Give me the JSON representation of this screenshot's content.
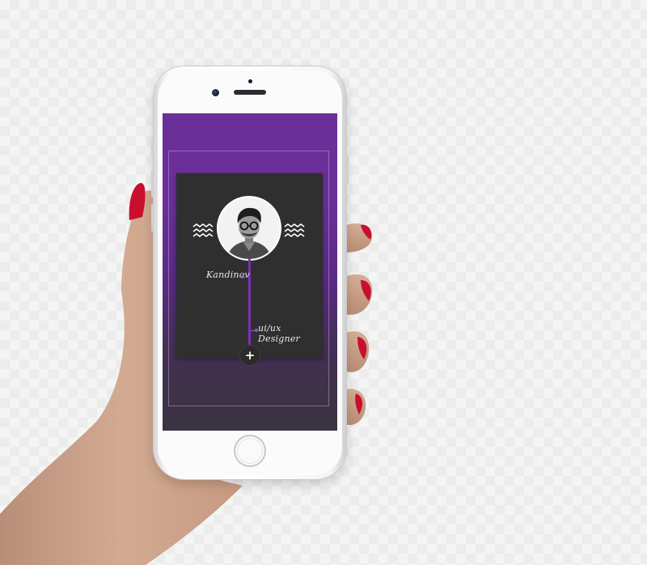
{
  "profile_card": {
    "name": "Kandinov",
    "role": "ui/ux Designer",
    "avatar_icon": "portrait-photo",
    "left_decoration_icon": "zigzag-wave-icon",
    "right_decoration_icon": "zigzag-wave-icon"
  },
  "actions": {
    "add_symbol": "+",
    "add_icon": "plus-icon"
  },
  "device": {
    "home_button_icon": "home-button"
  },
  "colors": {
    "screen_top": "#6a2f99",
    "screen_bottom": "#3a3340",
    "card_background": "#2f2f2f",
    "timeline_accent": "#7a32b0",
    "text": "#e8e8e8",
    "nail_polish": "#c8102e"
  }
}
